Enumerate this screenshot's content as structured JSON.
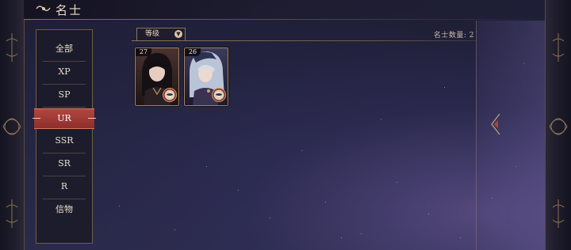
{
  "header": {
    "title": "名士",
    "icon": "swirl-emblem-icon"
  },
  "sidebar": {
    "items": [
      {
        "label": "全部",
        "active": false
      },
      {
        "label": "XP",
        "active": false
      },
      {
        "label": "SP",
        "active": false
      },
      {
        "label": "UR",
        "active": true
      },
      {
        "label": "SSR",
        "active": false
      },
      {
        "label": "SR",
        "active": false
      },
      {
        "label": "R",
        "active": false
      },
      {
        "label": "信物",
        "active": false
      }
    ]
  },
  "filter": {
    "label": "等级",
    "dropdown_icon": "chevron-down-icon"
  },
  "count_text": "名士数量: 2",
  "cards": [
    {
      "level": "27"
    },
    {
      "level": "26"
    }
  ],
  "colors": {
    "accent_red": "#9a3a35",
    "gold_border": "#8a7456",
    "text_cream": "#e7dcc8"
  }
}
